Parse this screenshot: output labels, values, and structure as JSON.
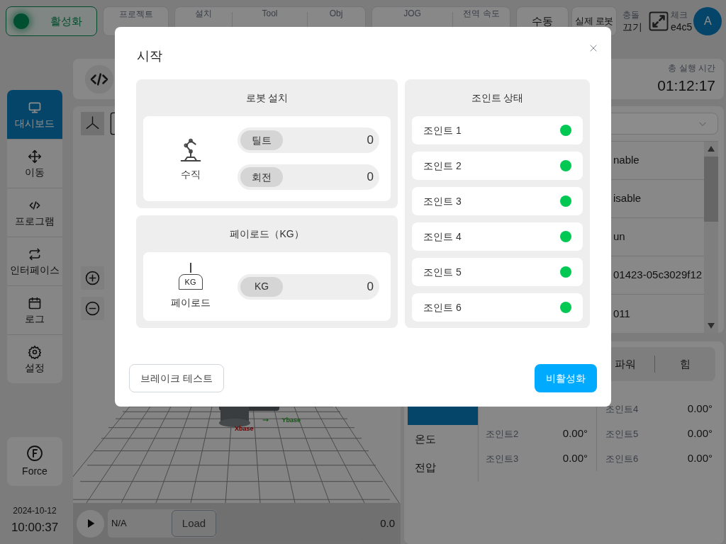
{
  "top_bar": {
    "activate_button": {
      "label": "활성화",
      "on": true
    },
    "project": {
      "label": "프로젝트"
    },
    "setup_fields": [
      {
        "label": "설치"
      },
      {
        "label": "Tool"
      },
      {
        "label": "Obj"
      }
    ],
    "jog_fields": [
      {
        "label": "JOG"
      },
      {
        "label": "전역 속도"
      }
    ],
    "mode_button": "수동",
    "robot_button": "실제 로봇",
    "collision": {
      "label": "충돌",
      "value": "끄기"
    },
    "check": {
      "label": "체크",
      "value": "e4c5"
    },
    "avatar": "A"
  },
  "sidebar": {
    "items": [
      {
        "label": "대시보드",
        "selected": true
      },
      {
        "label": "이동",
        "selected": false
      },
      {
        "label": "프로그램",
        "selected": false
      },
      {
        "label": "인터페이스",
        "selected": false
      },
      {
        "label": "로그",
        "selected": false
      },
      {
        "label": "설정",
        "selected": false
      }
    ],
    "force_button": "Force",
    "date": "2024-10-12",
    "time": "10:00:37"
  },
  "viewer": {
    "scene_labels": [
      "Xbase",
      "Ybase"
    ],
    "program_field": "N/A",
    "load_button": "Load",
    "reading": "0.0"
  },
  "runtime": {
    "label": "총 실행 시간",
    "value": "01:12:17"
  },
  "list_rows": [
    "nable",
    "isable",
    "un",
    "01423-05c3029f12",
    "011"
  ],
  "joint_panel": {
    "tabs": [
      "파워",
      "힘"
    ],
    "side_tabs": [
      {
        "selected": true
      },
      {
        "label": "온도",
        "selected": false
      },
      {
        "label": "전압",
        "selected": false
      }
    ],
    "readings": [
      {
        "label": "조인트2",
        "value": "0.00°"
      },
      {
        "label": "조인트3",
        "value": "0.00°"
      },
      {
        "label": "조인트4",
        "value": "0.00°"
      },
      {
        "label": "조인트5",
        "value": "0.00°"
      },
      {
        "label": "조인트6",
        "value": "0.00°"
      }
    ]
  },
  "dialog": {
    "title": "시작",
    "setup": {
      "title": "로봇 설치",
      "caption": "수직",
      "fields": [
        {
          "label": "틸트",
          "value": "0"
        },
        {
          "label": "회전",
          "value": "0"
        }
      ]
    },
    "payload": {
      "title": "페이로드（KG）",
      "icon_text": "KG",
      "caption": "페이로드",
      "fields": [
        {
          "label": "KG",
          "value": "0"
        }
      ]
    },
    "joints": {
      "title": "조인트 상태",
      "items": [
        {
          "label": "조인트 1",
          "ok": true
        },
        {
          "label": "조인트 2",
          "ok": true
        },
        {
          "label": "조인트 3",
          "ok": true
        },
        {
          "label": "조인트 4",
          "ok": true
        },
        {
          "label": "조인트 5",
          "ok": true
        },
        {
          "label": "조인트 6",
          "ok": true
        }
      ]
    },
    "buttons": [
      {
        "label": "브레이크 테스트",
        "kind": "secondary"
      },
      {
        "label": "비활성화",
        "kind": "primary"
      }
    ]
  }
}
